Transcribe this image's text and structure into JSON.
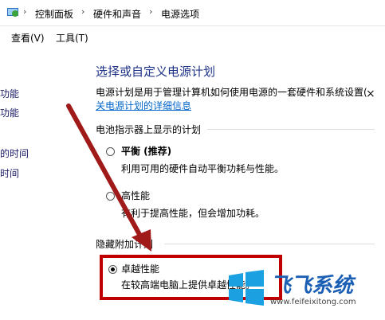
{
  "address": {
    "crumbs": [
      "控制面板",
      "硬件和声音",
      "电源选项"
    ],
    "separator": "›"
  },
  "menu": {
    "view": "查看(V)",
    "tools": "工具(T)"
  },
  "leftnav": {
    "items": [
      "功能",
      "功能",
      "的时间",
      "时间"
    ]
  },
  "main": {
    "heading": "选择或自定义电源计划",
    "description": "电源计划是用于管理计算机如何使用电源的一套硬件和系统设置(",
    "link": "关电源计划的详细信息",
    "battery_section": "电池指示器上显示的计划",
    "hidden_section": "隐藏附加计划",
    "plans": [
      {
        "name": "平衡 (推荐)",
        "desc": "利用可用的硬件自动平衡功耗与性能。",
        "selected": false
      },
      {
        "name": "高性能",
        "desc": "有利于提高性能，但会增加功耗。",
        "selected": false
      },
      {
        "name": "卓越性能",
        "desc": "在较高端电脑上提供卓越性能。",
        "selected": true
      }
    ]
  },
  "right_clip": "×",
  "watermark": {
    "brand": "飞飞系统",
    "url": "www.feifeixitong.com"
  },
  "colors": {
    "heading": "#1e3287",
    "link": "#0066cc",
    "highlight": "#c00000",
    "arrow": "#a11a1a",
    "win_blue": "#1ba1e2"
  }
}
